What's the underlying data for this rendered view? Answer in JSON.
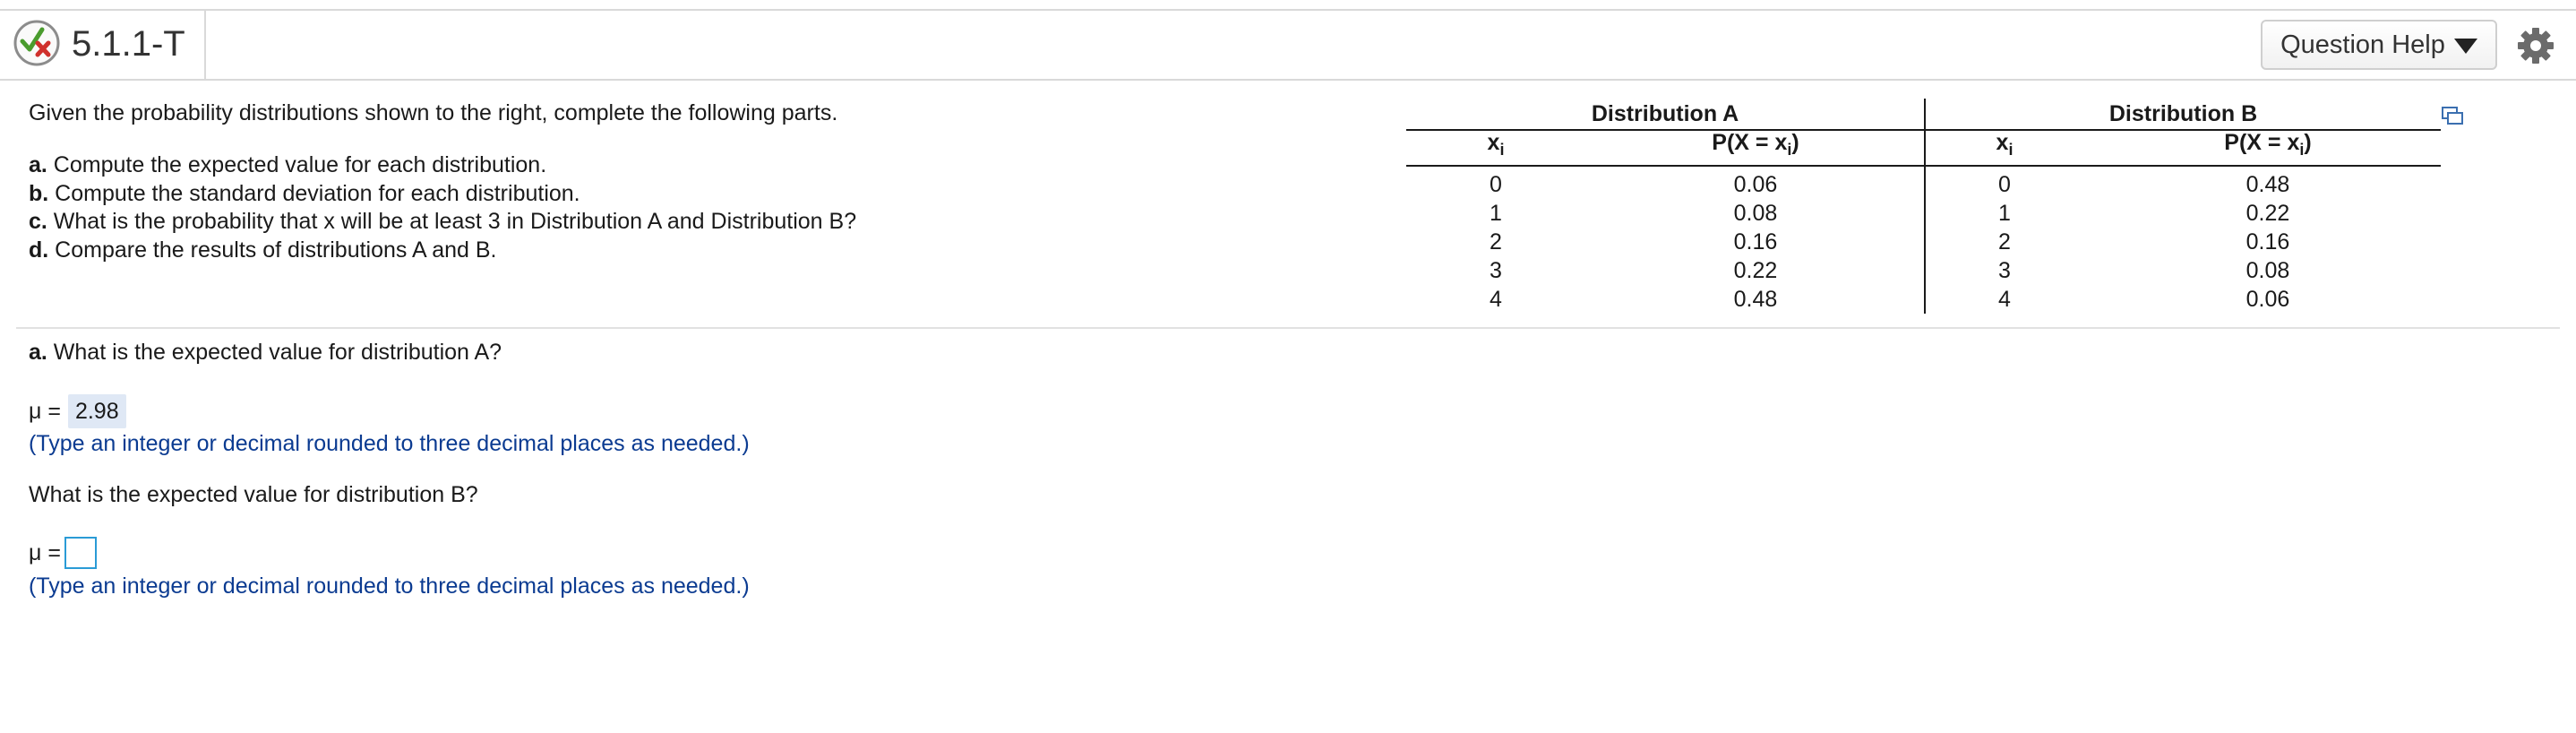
{
  "header": {
    "question_id": "5.1.1-T",
    "help_label": "Question Help"
  },
  "problem": {
    "intro": "Given the probability distributions shown to the right, complete the following parts.",
    "parts": [
      {
        "letter": "a.",
        "text": " Compute the expected value for each distribution."
      },
      {
        "letter": "b.",
        "text": " Compute the standard deviation for each distribution."
      },
      {
        "letter": "c.",
        "text": " What is the probability that x will be at least 3 in Distribution A and Distribution B?"
      },
      {
        "letter": "d.",
        "text": " Compare the results of distributions A and B."
      }
    ]
  },
  "table": {
    "dist_a": {
      "title": "Distribution A",
      "col_x": "xi",
      "col_p": "P(X = xi)",
      "x": [
        "0",
        "1",
        "2",
        "3",
        "4"
      ],
      "p": [
        "0.06",
        "0.08",
        "0.16",
        "0.22",
        "0.48"
      ]
    },
    "dist_b": {
      "title": "Distribution B",
      "col_x": "xi",
      "col_p": "P(X = xi)",
      "x": [
        "0",
        "1",
        "2",
        "3",
        "4"
      ],
      "p": [
        "0.48",
        "0.22",
        "0.16",
        "0.08",
        "0.06"
      ]
    }
  },
  "questions": {
    "a_letter": "a.",
    "a_question": " What is the expected value for distribution A?",
    "mu_label": "μ =",
    "a_answer": "2.98",
    "hint": "(Type an integer or decimal rounded to three decimal places as needed.)",
    "b_question": "What is the expected value for distribution B?",
    "b_answer": ""
  },
  "colors": {
    "hint_text": "#0b3b91",
    "input_border": "#2a9bd6",
    "answer_highlight": "#dfe8f5"
  },
  "icons": [
    "status-check-x-icon",
    "caret-down-icon",
    "gear-icon",
    "expand-icon"
  ]
}
